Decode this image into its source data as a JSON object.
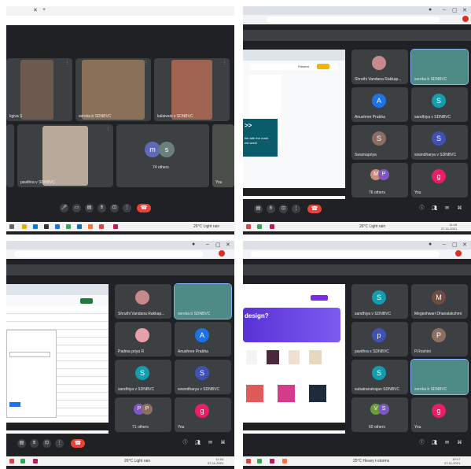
{
  "colors": {
    "accent": "#8ab4f8",
    "hangup": "#ea4335",
    "tile": "#3c4043",
    "bg": "#202124"
  },
  "q1": {
    "participants": [
      {
        "name": "kgiva S"
      },
      {
        "name": "sereka b SDNBVC"
      },
      {
        "name": "kalaivani s SDNBVC"
      },
      {
        "name": "pavithra v SDNBVC"
      },
      {
        "name": "You"
      }
    ],
    "others": {
      "initials": [
        "m",
        "s"
      ],
      "label": "74 others"
    },
    "weather": "26°C Light rain"
  },
  "q2": {
    "participants": [
      {
        "name": "Shruthi Vandana Rakkap..."
      },
      {
        "name": "sereka b SDNBVC"
      },
      {
        "initial": "A",
        "name": "Anushree Prabha"
      },
      {
        "initial": "S",
        "name": "sandhiya v SDNBVC"
      },
      {
        "initial": "S",
        "name": "Swarnapriya"
      },
      {
        "initial": "S",
        "name": "sowndharya v SDNBVC"
      },
      {
        "initial": "g",
        "name": "You"
      }
    ],
    "others": {
      "initials": [
        "M",
        "P"
      ],
      "label": "76 others"
    },
    "slide": {
      "arrow": ">>",
      "line1": "tile with the math",
      "line2": "est work!"
    },
    "weather": "26°C Light rain",
    "present_label": "Present",
    "clock": {
      "time": "11:19",
      "date": "27-11-2021"
    }
  },
  "q3": {
    "participants": [
      {
        "name": "Shruthi Vandana Rakkap..."
      },
      {
        "name": "sereka b SDNBVC"
      },
      {
        "name": "Padma priya R"
      },
      {
        "initial": "A",
        "name": "Anushree Prabha"
      },
      {
        "initial": "S",
        "name": "sandhiya v SDNBVC"
      },
      {
        "initial": "S",
        "name": "sowndharya v SDNBVC"
      },
      {
        "initial": "g",
        "name": "You"
      }
    ],
    "others": {
      "initials": [
        "P",
        "P"
      ],
      "label": "71 others"
    },
    "weather": "26°C Light rain",
    "clock": {
      "time": "11:04",
      "date": "27-11-2021"
    }
  },
  "q4": {
    "participants": [
      {
        "initial": "S",
        "name": "sandhiya v SDNBVC"
      },
      {
        "initial": "M",
        "name": "Megeshwari Dhanalakshmi"
      },
      {
        "initial": "p",
        "name": "pavithra s SDNBVC"
      },
      {
        "initial": "P",
        "name": "P.Roshini"
      },
      {
        "initial": "S",
        "name": "subatranatrajan SDNBVC"
      },
      {
        "name": "sereka b SDNBVC"
      },
      {
        "initial": "g",
        "name": "You"
      }
    ],
    "others": {
      "initials": [
        "V",
        "S"
      ],
      "label": "60 others"
    },
    "canva": {
      "heading": "design?"
    },
    "weather": "25°C Heavy t-storms",
    "clock": {
      "time": "10:17",
      "date": "27-11-2021"
    }
  }
}
